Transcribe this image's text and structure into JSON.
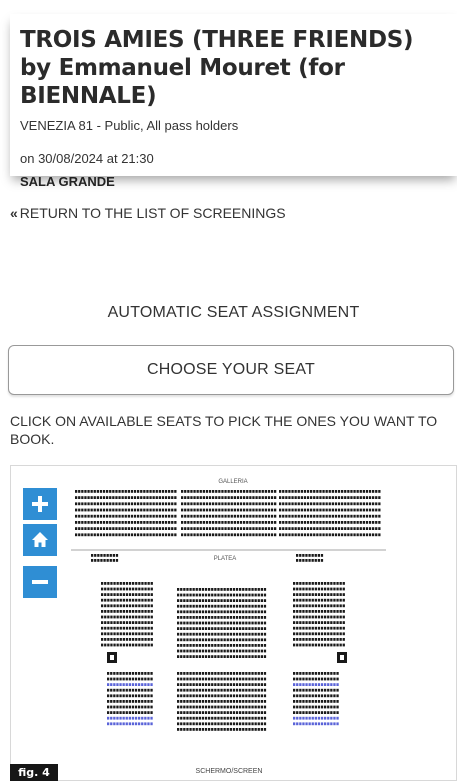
{
  "screening": {
    "title": "TROIS AMIES (THREE FRIENDS) by Emmanuel Mouret (for BIENNALE)",
    "subtitle": "VENEZIA 81 - Public, All pass holders",
    "datetime": "on 30/08/2024 at 21:30",
    "venue": "SALA GRANDE"
  },
  "nav": {
    "return_icon": "«",
    "return_label": "RETURN TO THE LIST OF SCREENINGS"
  },
  "booking": {
    "auto_label": "AUTOMATIC SEAT ASSIGNMENT",
    "choose_label": "CHOOSE YOUR SEAT",
    "instructions": "CLICK ON AVAILABLE SEATS TO PICK THE ONES YOU WANT TO BOOK."
  },
  "seatmap": {
    "galleria_label": "GALLERIA",
    "platea_label": "PLATEA",
    "screen_label": "SCHERMO/SCREEN",
    "zoom_in_icon": "plus-icon",
    "home_icon": "home-icon",
    "zoom_out_icon": "minus-icon",
    "seat_color": "#1a1a1a",
    "selected_seat_color": "#5a63d8",
    "zoom_color": "#2f8ed4"
  },
  "figure": {
    "label": "fig. 4"
  }
}
